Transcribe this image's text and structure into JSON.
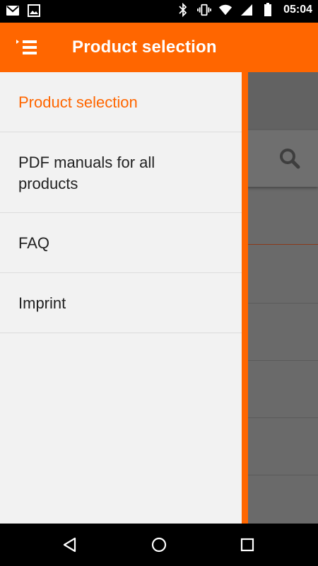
{
  "status_bar": {
    "time": "05:04",
    "left_icons": [
      "gmail-icon",
      "image-icon"
    ],
    "right_icons": [
      "bluetooth-icon",
      "vibrate-icon",
      "wifi-icon",
      "signal-icon",
      "battery-icon"
    ]
  },
  "app_bar": {
    "title": "Product selection",
    "menu_icon": "drawer-menu-icon",
    "color": "#FF6600"
  },
  "drawer": {
    "items": [
      {
        "label": "Product selection",
        "active": true
      },
      {
        "label": "PDF manuals for all products",
        "active": false
      },
      {
        "label": "FAQ",
        "active": false
      },
      {
        "label": "Imprint",
        "active": false
      }
    ]
  },
  "nav_bar": {
    "buttons": [
      "back-icon",
      "home-icon",
      "recents-icon"
    ]
  }
}
